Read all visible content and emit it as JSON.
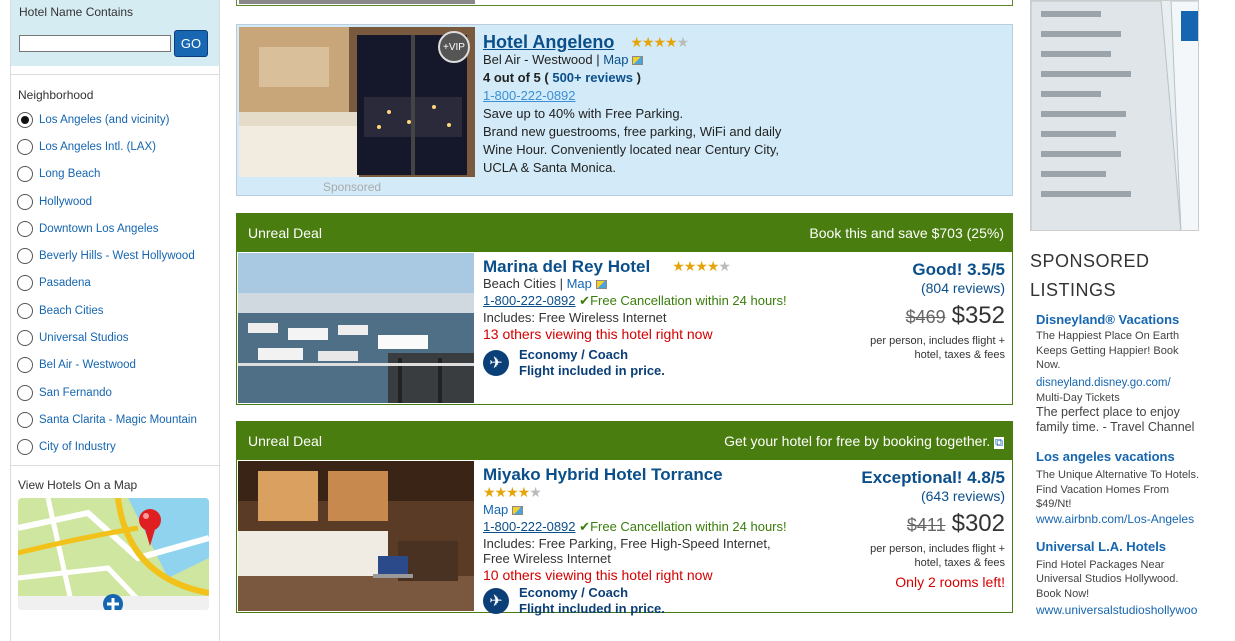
{
  "sidebar": {
    "search_label": "Hotel Name Contains",
    "search_value": "",
    "go_label": "GO",
    "neighborhood_title": "Neighborhood",
    "neighborhoods": [
      {
        "label": "Los Angeles (and vicinity)",
        "selected": true
      },
      {
        "label": "Los Angeles Intl. (LAX)",
        "selected": false
      },
      {
        "label": "Long Beach",
        "selected": false
      },
      {
        "label": "Hollywood",
        "selected": false
      },
      {
        "label": "Downtown Los Angeles",
        "selected": false
      },
      {
        "label": "Beverly Hills - West Hollywood",
        "selected": false
      },
      {
        "label": "Pasadena",
        "selected": false
      },
      {
        "label": "Beach Cities",
        "selected": false
      },
      {
        "label": "Universal Studios",
        "selected": false
      },
      {
        "label": "Bel Air - Westwood",
        "selected": false
      },
      {
        "label": "San Fernando",
        "selected": false
      },
      {
        "label": "Santa Clarita - Magic Mountain",
        "selected": false
      },
      {
        "label": "City of Industry",
        "selected": false
      }
    ],
    "map_title": "View Hotels On a Map"
  },
  "sponsored_hotel": {
    "badge": "+VIP",
    "name": "Hotel Angeleno",
    "rating_stars": 3.5,
    "location": "Bel Air - Westwood",
    "map_link": "Map",
    "rating_prefix": "4 out of 5 (",
    "reviews_link": "500+ reviews",
    "rating_suffix": ")",
    "phone": "1-800-222-0892",
    "promo": "Save up to 40% with Free Parking.",
    "desc_lines": [
      "Brand new guestrooms, free parking, WiFi and daily",
      "Wine Hour. Conveniently located near Century City,",
      "UCLA & Santa Monica."
    ],
    "sponsored_label": "Sponsored"
  },
  "deals": [
    {
      "head_left": "Unreal Deal",
      "head_right": "Book this and save $703 (25%)",
      "name": "Marina del Rey Hotel",
      "rating_stars": 4,
      "location": "Beach Cities",
      "map_link": "Map",
      "phone": "1-800-222-0892",
      "cancellation": "Free Cancellation within 24 hours!",
      "includes": "Includes: Free Wireless Internet",
      "viewing": "13 others viewing this hotel right now",
      "flight_class": "Economy / Coach",
      "flight_note": "Flight included in price.",
      "score": "Good! 3.5/5",
      "reviews": "(804 reviews)",
      "old_price": "$469",
      "price": "$352",
      "per_line1": "per person,  includes flight +",
      "per_line2": "hotel, taxes & fees",
      "rooms_left": ""
    },
    {
      "head_left": "Unreal Deal",
      "head_right": "Get your hotel for free by booking together.",
      "name": "Miyako Hybrid Hotel Torrance",
      "rating_stars": 3.5,
      "location": "",
      "map_link": "Map",
      "phone": "1-800-222-0892",
      "cancellation": "Free Cancellation within 24 hours!",
      "includes": "Includes: Free Parking, Free High-Speed Internet,",
      "includes2": "Free Wireless Internet",
      "viewing": "10 others viewing this hotel right now",
      "flight_class": "Economy / Coach",
      "flight_note": "Flight included in price.",
      "score": "Exceptional! 4.8/5",
      "reviews": "(643 reviews)",
      "old_price": "$411",
      "price": "$302",
      "per_line1": "per person,  includes flight +",
      "per_line2": "hotel, taxes & fees",
      "rooms_left": "Only 2 rooms left!"
    }
  ],
  "right": {
    "heading_line1": "SPONSORED",
    "heading_line2": "LISTINGS",
    "ads": [
      {
        "title": "Disneyland® Vacations",
        "desc": "The Happiest Place On Earth Keeps Getting Happier! Book Now.",
        "url": "disneyland.disney.go.com/",
        "extra_small": "Multi-Day Tickets",
        "extra": "The perfect place to enjoy family time. - Travel Channel"
      },
      {
        "title": "Los angeles vacations",
        "desc": "The Unique Alternative To Hotels. Find Vacation Homes From $49/Nt!",
        "url": "www.airbnb.com/Los-Angeles"
      },
      {
        "title": "Universal L.A. Hotels",
        "desc": "Find Hotel Packages Near Universal Studios Hollywood. Book Now!",
        "url": "www.universalstudioshollywoo"
      }
    ]
  }
}
